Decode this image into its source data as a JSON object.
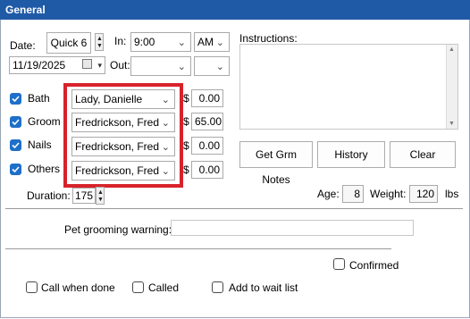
{
  "window": {
    "title": "General"
  },
  "appointment": {
    "date_label": "Date:",
    "quick_button": "Quick 6",
    "in_label": "In:",
    "in_time": "9:00",
    "in_ampm": "AM",
    "date_value": "11/19/2025",
    "out_label": "Out:",
    "out_time": "",
    "out_ampm": ""
  },
  "instructions": {
    "label": "Instructions:",
    "value": ""
  },
  "services": [
    {
      "name": "Bath",
      "checked": true,
      "groomer": "Lady, Danielle",
      "currency": "$",
      "amount": "0.00"
    },
    {
      "name": "Groom",
      "checked": true,
      "groomer": "Fredrickson, Fred",
      "currency": "$",
      "amount": "65.00"
    },
    {
      "name": "Nails",
      "checked": true,
      "groomer": "Fredrickson, Fred",
      "currency": "$",
      "amount": "0.00"
    },
    {
      "name": "Others",
      "checked": true,
      "groomer": "Fredrickson, Fred",
      "currency": "$",
      "amount": "0.00"
    }
  ],
  "actions": {
    "grm_notes": "Get Grm Notes",
    "history": "History",
    "clear": "Clear"
  },
  "duration": {
    "label": "Duration:",
    "value": "175"
  },
  "pet": {
    "age_label": "Age:",
    "age": "8",
    "weight_label": "Weight:",
    "weight": "120",
    "weight_unit": "lbs"
  },
  "warning": {
    "label": "Pet grooming warning:",
    "value": ""
  },
  "options": {
    "confirmed": "Confirmed",
    "call_when_done": "Call when done",
    "called": "Called",
    "add_to_wait_list": "Add to wait list"
  },
  "colors": {
    "title_bar": "#1f5aa6",
    "checkbox_on": "#1e6fc9",
    "highlight": "#d8222a"
  }
}
